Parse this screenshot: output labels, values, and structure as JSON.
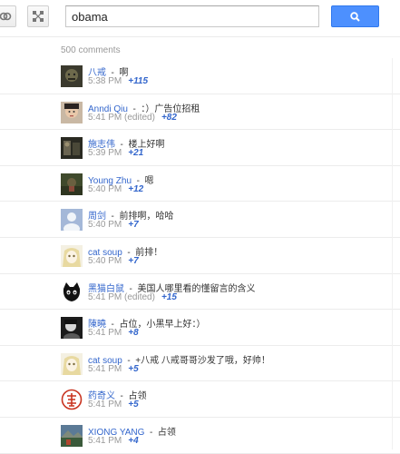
{
  "search": {
    "value": "obama"
  },
  "comment_count": "500 comments",
  "colors": {
    "link": "#3366cc",
    "accent": "#4d90fe",
    "muted": "#999999"
  },
  "toolbar": {
    "left_icon": "link-circles-icon",
    "right_icon": "network-nodes-icon",
    "search_icon": "magnifier-icon"
  },
  "comments": [
    {
      "author": "八戒",
      "text": "啊",
      "time": "5:38 PM",
      "edited": "",
      "plus": "+115",
      "avatar": "dark"
    },
    {
      "author": "Anndi Qiu",
      "text": "：）广告位招租",
      "time": "5:41 PM",
      "edited": "(edited)",
      "plus": "+82",
      "avatar": "face"
    },
    {
      "author": "施志伟",
      "text": "楼上好啊",
      "time": "5:39 PM",
      "edited": "",
      "plus": "+21",
      "avatar": "dark2"
    },
    {
      "author": "Young Zhu",
      "text": "嗯",
      "time": "5:40 PM",
      "edited": "",
      "plus": "+12",
      "avatar": "outdoor"
    },
    {
      "author": "周剑",
      "text": "前排啊，哈哈",
      "time": "5:40 PM",
      "edited": "",
      "plus": "+7",
      "avatar": "default"
    },
    {
      "author": "cat soup",
      "text": "前排！",
      "time": "5:40 PM",
      "edited": "",
      "plus": "+7",
      "avatar": "anime"
    },
    {
      "author": "黑猫白鼠",
      "text": "美国人哪里看的懂留言的含义",
      "time": "5:41 PM",
      "edited": "(edited)",
      "plus": "+15",
      "avatar": "cat"
    },
    {
      "author": "陳曉",
      "text": "占位，小黑早上好：）",
      "time": "5:41 PM",
      "edited": "",
      "plus": "+8",
      "avatar": "bw"
    },
    {
      "author": "cat soup",
      "text": "+八戒 八戒哥哥沙发了哦，好帅！",
      "time": "5:41 PM",
      "edited": "",
      "plus": "+5",
      "avatar": "anime"
    },
    {
      "author": "药奇义",
      "text": "占领",
      "time": "5:41 PM",
      "edited": "",
      "plus": "+5",
      "avatar": "seal"
    },
    {
      "author": "XIONG YANG",
      "text": "占领",
      "time": "5:41 PM",
      "edited": "",
      "plus": "+4",
      "avatar": "landscape"
    }
  ]
}
